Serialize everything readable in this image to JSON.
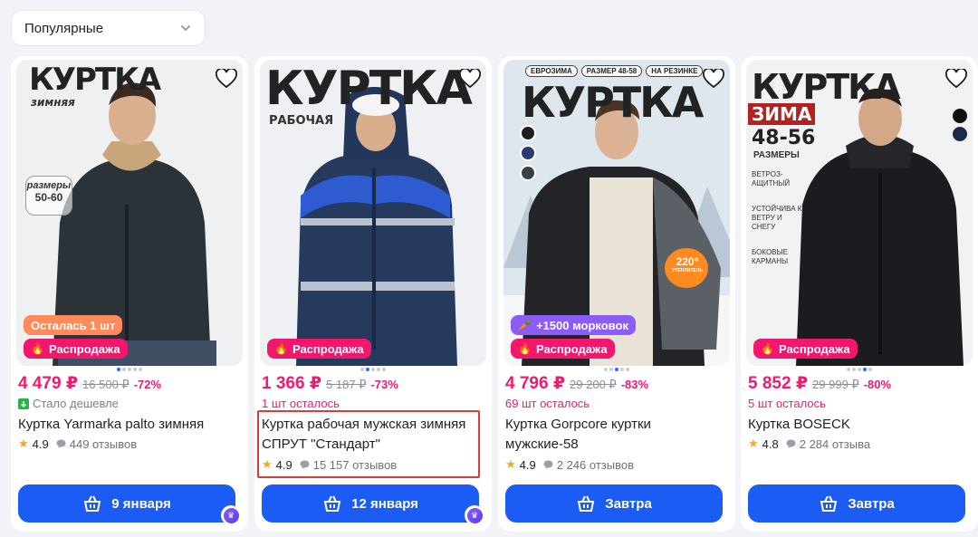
{
  "sort": {
    "label": "Популярные",
    "icon": "chevron-down-icon"
  },
  "colors": {
    "accent": "#1b5cf5",
    "price": "#f01b6e",
    "sale_badge": "#f0176d",
    "stock_badge": "#ff8a5c",
    "bonus_badge": "#8b5cf6"
  },
  "products": [
    {
      "image_headline": "КУРТКА",
      "image_sub": "зимняя",
      "image_tag": "размеры",
      "image_tag2": "50-60",
      "stock_badge": "Осталась 1 шт",
      "sale_badge": "Распродажа",
      "price": "4 479 ₽",
      "old_price": "16 500 ₽",
      "discount": "-72%",
      "note": "Стало дешевле",
      "title": "Куртка Yarmarka palto зимняя",
      "rating": "4.9",
      "reviews": "449 отзывов",
      "delivery": "9 января"
    },
    {
      "image_headline": "КУРТКА",
      "image_sub": "РАБОЧАЯ",
      "sale_badge": "Распродажа",
      "price": "1 366 ₽",
      "old_price": "5 187 ₽",
      "discount": "-73%",
      "note": "1 шт осталось",
      "title": "Куртка рабочая мужская зимняя СПРУТ \"Стандарт\"",
      "rating": "4.9",
      "reviews": "15 157 отзывов",
      "delivery": "12 января"
    },
    {
      "image_headline": "КУРТКА",
      "image_chips": [
        "ЕВРОЗИМА",
        "РАЗМЕР 48-58",
        "НА РЕЗИНКЕ"
      ],
      "image_badge_num": "220°",
      "image_badge_text": "УТЕПЛИТЕЛЬ",
      "bonus_badge": "+1500 морковок",
      "sale_badge": "Распродажа",
      "price": "4 796 ₽",
      "old_price": "29 200 ₽",
      "discount": "-83%",
      "note": "69 шт осталось",
      "title": "Куртка Gorpcore куртки мужские-58",
      "rating": "4.9",
      "reviews": "2 246 отзывов",
      "delivery": "Завтра"
    },
    {
      "image_headline": "КУРТКА",
      "image_zima": "ЗИМА",
      "image_sizes": "48-56",
      "image_sizes_label": "РАЗМЕРЫ",
      "image_features": [
        "ВЕТРОЗ-АЩИТНЫЙ",
        "УСТОЙЧИВА К ВЕТРУ И СНЕГУ",
        "БОКОВЫЕ КАРМАНЫ"
      ],
      "sale_badge": "Распродажа",
      "price": "5 852 ₽",
      "old_price": "29 999 ₽",
      "discount": "-80%",
      "note": "5 шт осталось",
      "title": "Куртка BOSECK",
      "rating": "4.8",
      "reviews": "2 284 отзыва",
      "delivery": "Завтра"
    }
  ]
}
